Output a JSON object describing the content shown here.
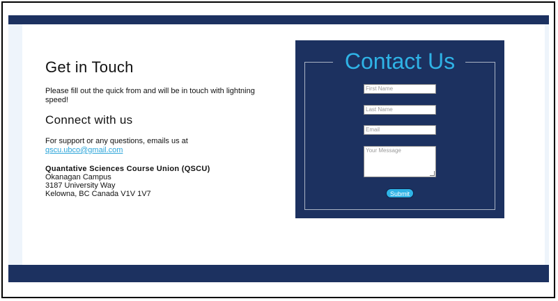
{
  "left": {
    "heading": "Get in Touch",
    "intro": "Please fill out the quick from and will be in touch with lightning speed!",
    "connect_heading": "Connect with us",
    "support_text": "For support or any questions, emails us at",
    "email": "qscu.ubco@gmail.com",
    "org_name": "Quantative Sciences Course Union (QSCU)",
    "address_line1": "Okanagan Campus",
    "address_line2": "3187 University Way",
    "address_line3": "Kelowna, BC Canada V1V 1V7"
  },
  "form": {
    "title": "Contact Us",
    "first_name_placeholder": "First Name",
    "last_name_placeholder": "Last Name",
    "email_placeholder": "Email",
    "message_placeholder": "Your Message",
    "submit_label": "Submit"
  },
  "colors": {
    "navy": "#1c3160",
    "accent": "#2fb3e6"
  }
}
